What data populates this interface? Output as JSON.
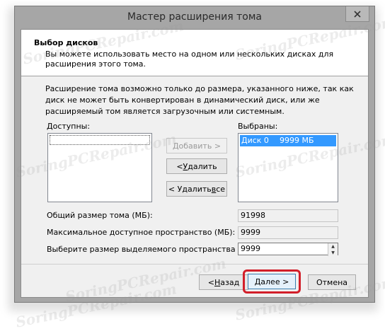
{
  "window": {
    "title": "Мастер расширения тома"
  },
  "header": {
    "title": "Выбор дисков",
    "description": "Вы можете использовать место на одном или нескольких дисках для расширения этого тома."
  },
  "info_text": "Расширение тома возможно только до размера, указанного ниже, так как диск не может быть конвертирован в динамический диск, или же расширяемый том является загрузочным или системным.",
  "available": {
    "label": "Доступны:",
    "items": []
  },
  "selected": {
    "label": "Выбраны:",
    "items": [
      {
        "disk": "Диск 0",
        "size": "9999 МБ"
      }
    ]
  },
  "buttons": {
    "add": {
      "label_pre": "",
      "label_ul": "Д",
      "label_post": "обавить >",
      "enabled": false
    },
    "remove": {
      "label_pre": "< ",
      "label_ul": "У",
      "label_post": "далить"
    },
    "remove_all": {
      "label_pre": "< Удалить ",
      "label_ul": "в",
      "label_post": "се"
    }
  },
  "fields": {
    "total": {
      "label": "Общий размер тома (МБ):",
      "value": "91998"
    },
    "max_space": {
      "label": "Максимальное доступное пространство (МБ):",
      "value": "9999"
    },
    "alloc": {
      "label": "Выберите размер выделяемого пространства (МБ):",
      "value": "9999"
    }
  },
  "footer": {
    "back": {
      "label_pre": "< ",
      "label_ul": "Н",
      "label_post": "азад"
    },
    "next": {
      "label_pre": "",
      "label_ul": "Д",
      "label_post": "алее >"
    },
    "cancel": "Отмена"
  },
  "watermark": "SoringPCRepair.com",
  "colors": {
    "selection": "#3399ff",
    "highlight": "#d21f2a"
  }
}
